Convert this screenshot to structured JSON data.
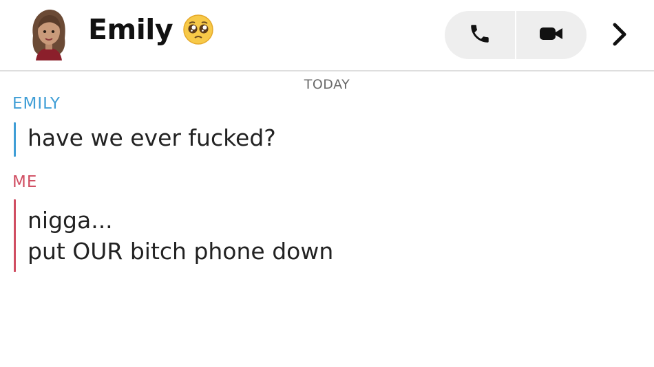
{
  "header": {
    "contact_name": "Emily",
    "status_emoji": "pleading-face-emoji",
    "avatar": "bitmoji-avatar",
    "call_icon": "phone-icon",
    "video_icon": "video-camera-icon",
    "more_icon": "chevron-right-icon"
  },
  "chat": {
    "date_label": "TODAY",
    "groups": [
      {
        "sender": "EMILY",
        "color": "#3f9ed6",
        "messages": [
          "have we ever fucked?"
        ]
      },
      {
        "sender": "ME",
        "color": "#d04e62",
        "messages": [
          "nigga...",
          "put OUR bitch phone down"
        ]
      }
    ]
  }
}
